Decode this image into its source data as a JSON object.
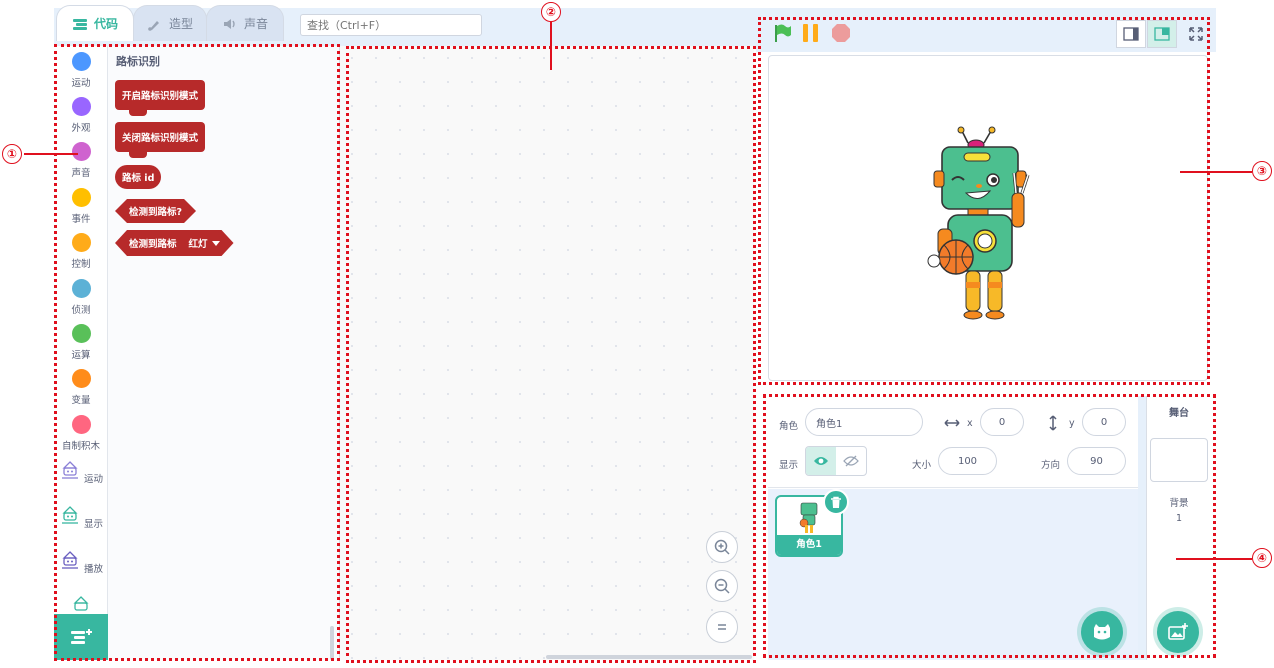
{
  "tabs": {
    "code": "代码",
    "costume": "造型",
    "sound": "声音"
  },
  "search": {
    "placeholder": "查找（Ctrl+F）"
  },
  "categories": [
    {
      "label": "运动",
      "color": "#4c97ff"
    },
    {
      "label": "外观",
      "color": "#9966ff"
    },
    {
      "label": "声音",
      "color": "#cf63cf"
    },
    {
      "label": "事件",
      "color": "#ffbf00"
    },
    {
      "label": "控制",
      "color": "#ffab19"
    },
    {
      "label": "侦测",
      "color": "#5cb1d6"
    },
    {
      "label": "运算",
      "color": "#59c059"
    },
    {
      "label": "变量",
      "color": "#ff8c1a"
    },
    {
      "label": "自制积木",
      "color": "#ff6680"
    }
  ],
  "extensions": [
    {
      "label": "运动",
      "icon": "robot-motion-icon"
    },
    {
      "label": "显示",
      "icon": "robot-display-icon"
    },
    {
      "label": "播放",
      "icon": "robot-play-icon"
    }
  ],
  "palette": {
    "title": "路标识别",
    "block_color": "#b72a2a",
    "blocks": [
      {
        "type": "command",
        "text": "开启路标识别模式"
      },
      {
        "type": "command",
        "text": "关闭路标识别模式"
      },
      {
        "type": "reporter",
        "text": "路标 id"
      },
      {
        "type": "boolean",
        "text": "检测到路标?"
      },
      {
        "type": "boolean",
        "text": "检测到路标",
        "dropdown": "红灯"
      }
    ]
  },
  "sprite": {
    "label_sprite": "角色",
    "name": "角色1",
    "label_x": "x",
    "x": "0",
    "label_y": "y",
    "y": "0",
    "label_show": "显示",
    "label_size": "大小",
    "size": "100",
    "label_direction": "方向",
    "direction": "90"
  },
  "sprite_list": [
    {
      "name": "角色1"
    }
  ],
  "backdrop": {
    "title": "舞台",
    "label": "背景",
    "count": "1"
  },
  "accent_color": "#38b7a0",
  "annotations": [
    "①",
    "②",
    "③",
    "④"
  ]
}
